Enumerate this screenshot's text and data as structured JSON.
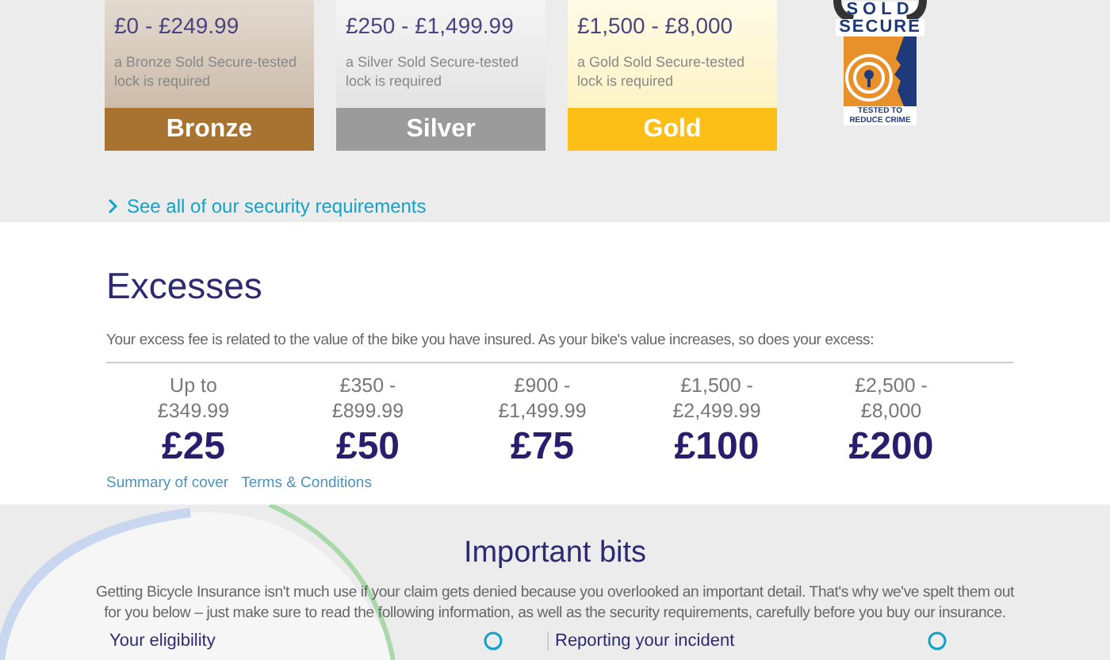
{
  "tiers": [
    {
      "kind": "bronze",
      "range": "£0 - £249.99",
      "note": "a Bronze Sold Secure-tested lock is required",
      "label": "Bronze"
    },
    {
      "kind": "silver",
      "range": "£250 - £1,499.99",
      "note": "a Silver Sold Secure-tested lock is required",
      "label": "Silver"
    },
    {
      "kind": "gold",
      "range": "£1,500 - £8,000",
      "note": "a Gold Sold Secure-tested lock is required",
      "label": "Gold"
    }
  ],
  "logo": {
    "top": "SOLD",
    "middle": "SECURE",
    "bottom": "TESTED TO REDUCE CRIME"
  },
  "security_link": "See all of our security requirements",
  "excesses": {
    "title": "Excesses",
    "intro": "Your excess fee is related to the value of the bike you have insured. As your bike's value increases, so does your excess:",
    "bands": [
      {
        "range": "Up to £349.99",
        "fee": "£25"
      },
      {
        "range": "£350 - £899.99",
        "fee": "£50"
      },
      {
        "range": "£900 - £1,499.99",
        "fee": "£75"
      },
      {
        "range": "£1,500 - £2,499.99",
        "fee": "£100"
      },
      {
        "range": "£2,500 - £8,000",
        "fee": "£200"
      }
    ],
    "links": [
      "Summary of cover",
      "Terms & Conditions"
    ]
  },
  "important": {
    "title": "Important bits",
    "text": "Getting Bicycle Insurance isn't much use if your claim gets denied because you overlooked an important detail. That's why we've spelt them out for you below – just make sure to read the following information, as well as the security requirements, carefully before you buy our insurance.",
    "sections": [
      "Your eligibility",
      "Reporting your incident"
    ]
  }
}
